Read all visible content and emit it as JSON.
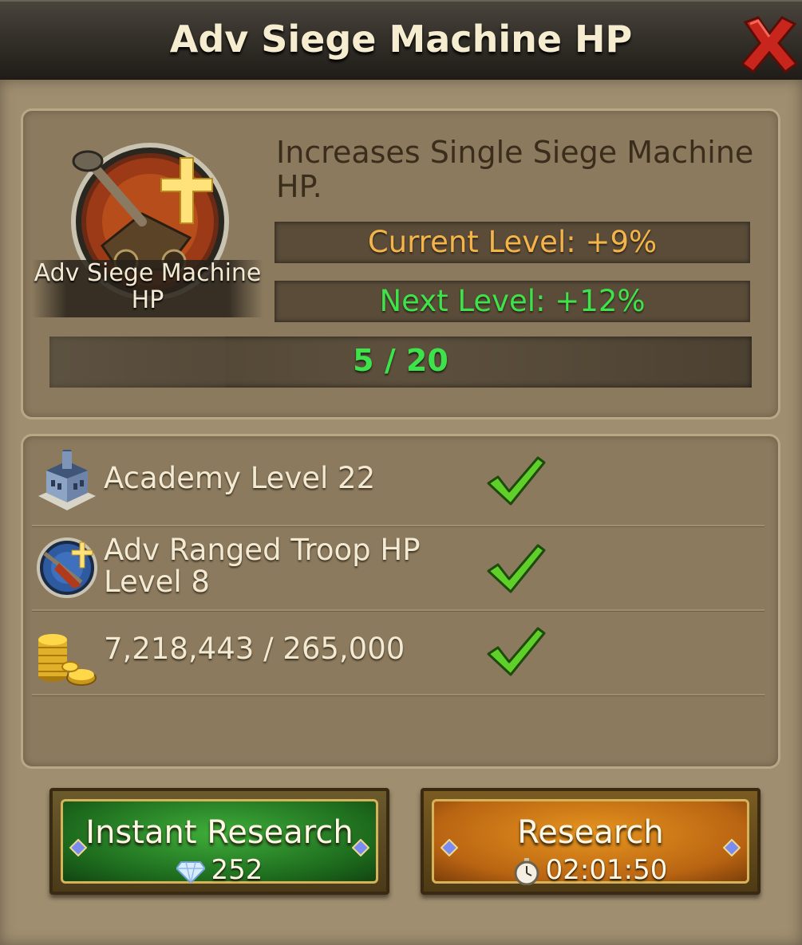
{
  "window": {
    "title": "Adv Siege Machine HP"
  },
  "tech": {
    "name": "Adv Siege Machine HP",
    "description": "Increases Single Siege Machine HP.",
    "current_level_text": "Current Level: +9%",
    "next_level_text": "Next Level: +12%",
    "progress_text": "5 / 20",
    "progress": {
      "current": 5,
      "max": 20
    }
  },
  "requirements": [
    {
      "icon": "academy-building-icon",
      "text": "Academy Level 22",
      "met": true
    },
    {
      "icon": "ranged-troop-hp-icon",
      "text": "Adv Ranged Troop HP Level 8",
      "met": true
    },
    {
      "icon": "gold-coins-icon",
      "text": "7,218,443 / 265,000",
      "met": true
    }
  ],
  "buttons": {
    "instant": {
      "label": "Instant Research",
      "cost": "252",
      "icon": "diamond-icon"
    },
    "research": {
      "label": "Research",
      "time": "02:01:50",
      "icon": "stopwatch-icon"
    }
  },
  "colors": {
    "current_level": "#f4b44a",
    "next_level": "#3ee24a",
    "progress_text": "#3ee24a",
    "instant_button": "#1d6a1d",
    "research_button": "#b96412"
  }
}
